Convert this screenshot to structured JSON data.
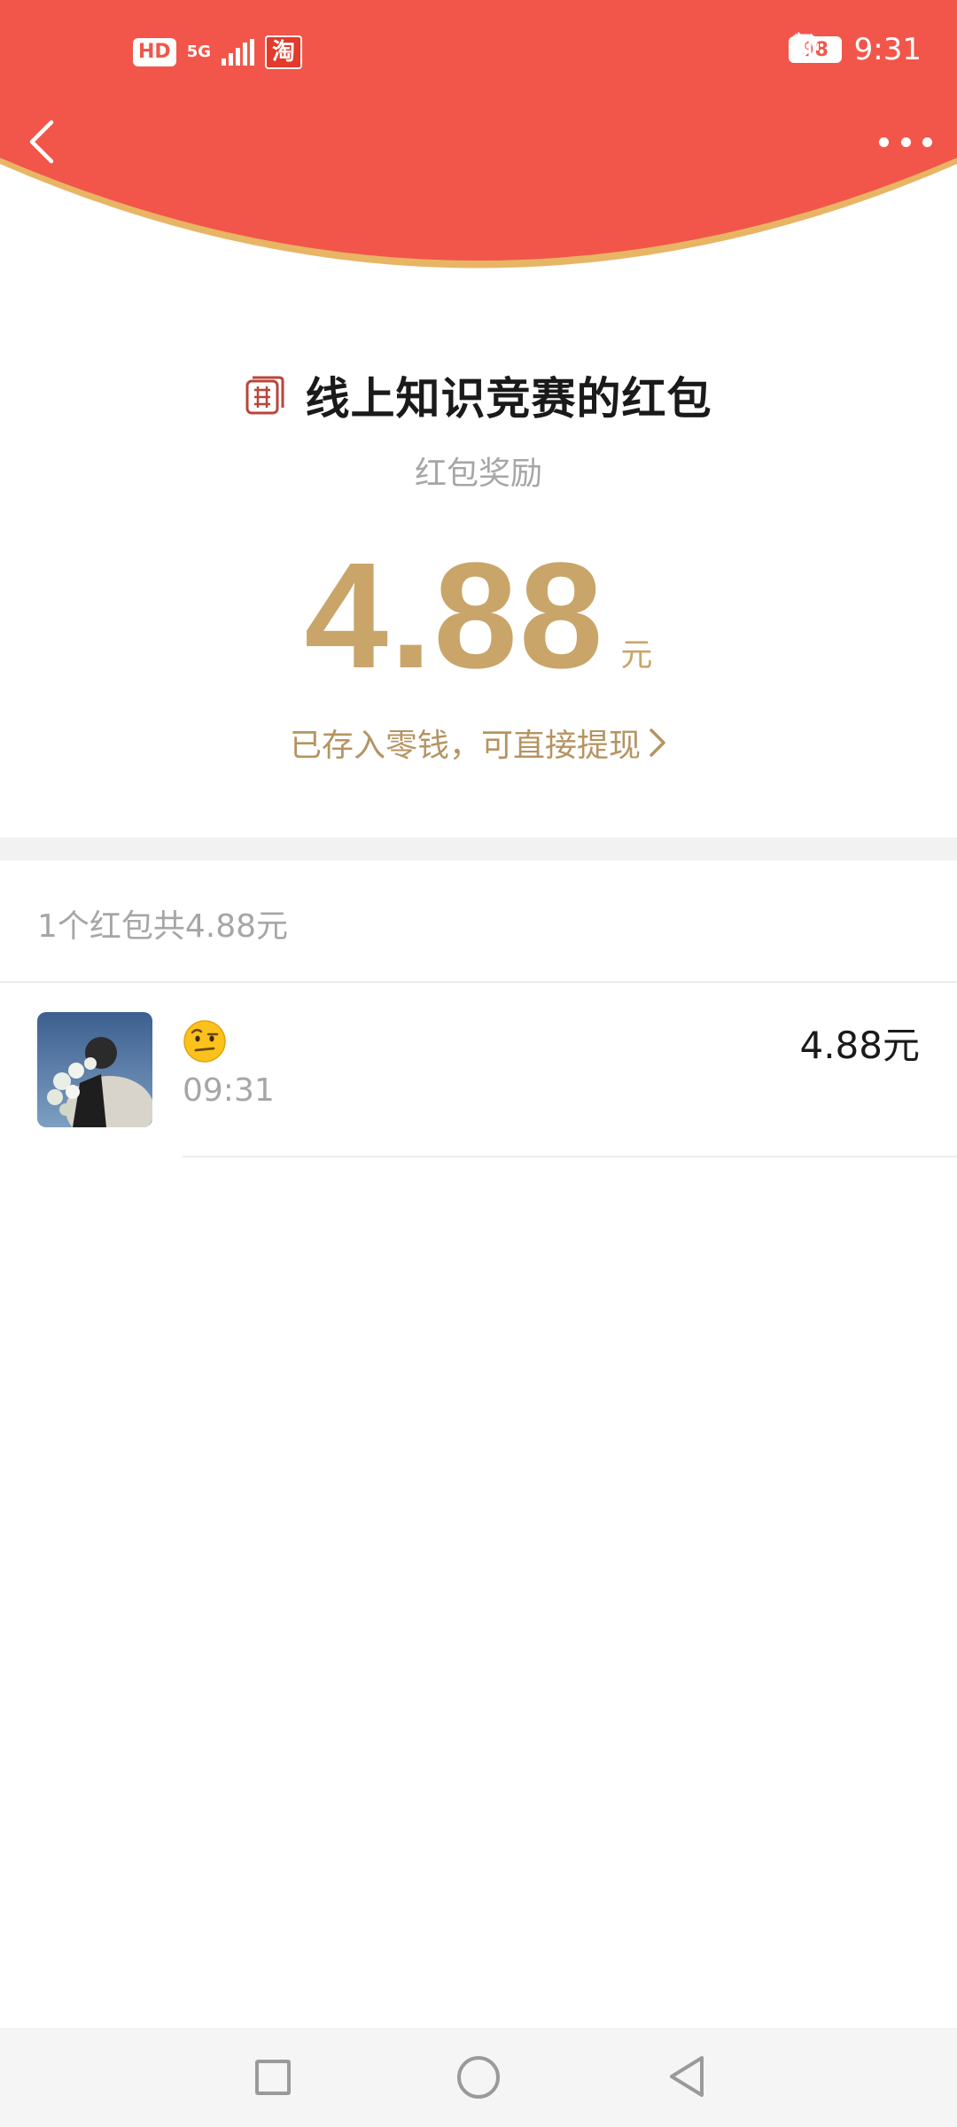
{
  "status_bar": {
    "hd_label": "HD",
    "network_label": "5G",
    "taobao_label": "淘",
    "battery": "98",
    "time": "9:31"
  },
  "header": {
    "bg_color": "#f2564a",
    "rim_color": "#e8b565"
  },
  "redpacket": {
    "title": "线上知识竞赛的红包",
    "subtitle": "红包奖励",
    "amount": "4.88",
    "amount_unit": "元",
    "deposit_text": "已存入零钱，可直接提现",
    "accent_color": "#c9a56a"
  },
  "summary": {
    "text": "1个红包共4.88元"
  },
  "items": [
    {
      "emoji": "🤨",
      "time": "09:31",
      "amount": "4.88元"
    }
  ]
}
